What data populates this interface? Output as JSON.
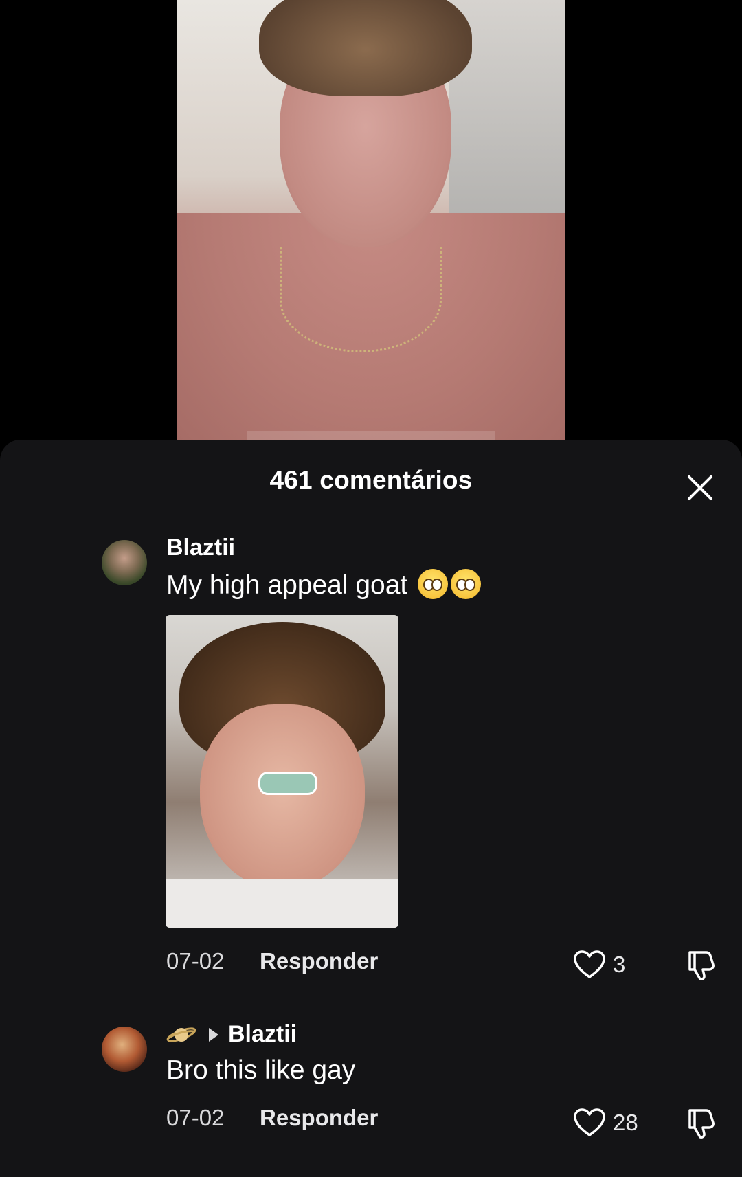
{
  "sheet": {
    "title": "461 comentários"
  },
  "comments": [
    {
      "username": "Blaztii",
      "text": "My high appeal goat",
      "emojis": [
        "pleading-face-emoji",
        "pleading-face-emoji"
      ],
      "date": "07-02",
      "reply_label": "Responder",
      "likes": "3"
    },
    {
      "reply_to": "Blaztii",
      "user_badge": "saturn-emoji",
      "text": "Bro this like gay",
      "date": "07-02",
      "reply_label": "Responder",
      "likes": "28"
    }
  ],
  "icons": {
    "close": "close-icon",
    "like": "heart-icon",
    "dislike": "thumbs-down-icon"
  },
  "colors": {
    "sheet_bg": "#141416",
    "text": "#ffffff",
    "muted": "#d9d9db"
  }
}
